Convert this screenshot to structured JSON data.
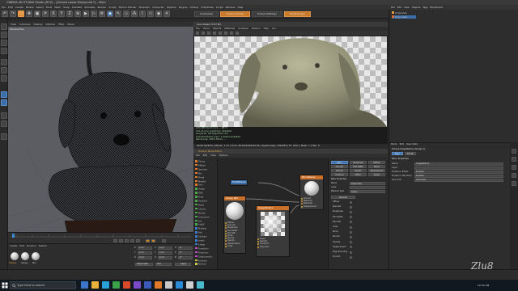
{
  "window": {
    "title": "CINEMA 4D STUDIO Studio (R19) – [Octane Loose Glossy.c4d *] – Main"
  },
  "menubar": [
    "File",
    "Edit",
    "Create",
    "Modes",
    "Select",
    "Tools",
    "Mesh",
    "Snap",
    "Animate",
    "Simulate",
    "Render",
    "Sculpt",
    "Motion Tracker",
    "MoGraph",
    "Character",
    "Pipeline",
    "Plugins",
    "Octane",
    "X-Particles",
    "Script",
    "Window",
    "Help"
  ],
  "toolbar": {
    "pills": [
      "LiveViewer",
      "Octane Render",
      "Octane Settings",
      "Tag Manager"
    ]
  },
  "viewport": {
    "menu": [
      "View",
      "Cameras",
      "Display",
      "Options",
      "Filter",
      "Panel"
    ],
    "label": "Perspective"
  },
  "render_view": {
    "title": "Live Viewer 3.07-R2",
    "menu": [
      "File",
      "Cloud",
      "Objects",
      "Materials",
      "Compare",
      "Options",
      "Help",
      "Gui"
    ],
    "status_line": "00:00:00/20/0  |  Ms/sec: 1.37  |  Time: 00:00:04/00:00:04  |  Spp/maxspp: 256/256  |  Tri: 0/3m  |  Mesh: 7  |  Hair: 0",
    "info_lines": [
      "GTX 980 Ti[1/1]  1/2  ...  98°C",
      "Out-of-core used/max: 0Kb/4Gb",
      "Grey8/16: 0/0  Rgb32/64: 0/1",
      "Used/free/total vram: 1.4Gb/4.2Gb/6Gb",
      "Rendering: 100%  Mode: ..."
    ]
  },
  "node_editor": {
    "title": "Octane Node Editor",
    "menu": [
      "File",
      "Edit",
      "View",
      "Options"
    ],
    "node_list": [
      {
        "label": "Glossy",
        "color": "#e07a2a"
      },
      {
        "label": "Diffuse",
        "color": "#e07a2a"
      },
      {
        "label": "Specular",
        "color": "#e07a2a"
      },
      {
        "label": "Mix",
        "color": "#e07a2a"
      },
      {
        "label": "Portal",
        "color": "#e07a2a"
      },
      {
        "label": "Metallic",
        "color": "#e07a2a"
      },
      {
        "label": "Toon",
        "color": "#e07a2a"
      },
      {
        "label": "Image",
        "color": "#4aa84a"
      },
      {
        "label": "RGB",
        "color": "#4aa84a"
      },
      {
        "label": "Float",
        "color": "#4aa84a"
      },
      {
        "label": "Gradient",
        "color": "#4aa84a"
      },
      {
        "label": "Noise",
        "color": "#4aa84a"
      },
      {
        "label": "Checks",
        "color": "#4aa84a"
      },
      {
        "label": "Marble",
        "color": "#4aa84a"
      },
      {
        "label": "Turbulence",
        "color": "#4aa84a"
      },
      {
        "label": "Dirt",
        "color": "#4aa84a"
      },
      {
        "label": "Falloff",
        "color": "#4aa84a"
      },
      {
        "label": "Multiply",
        "color": "#3a7ac8"
      },
      {
        "label": "Add",
        "color": "#3a7ac8"
      },
      {
        "label": "Subtract",
        "color": "#3a7ac8"
      },
      {
        "label": "Invert",
        "color": "#3a7ac8"
      },
      {
        "label": "Clamp",
        "color": "#3a7ac8"
      },
      {
        "label": "Transform",
        "color": "#c84ac8"
      },
      {
        "label": "Projection",
        "color": "#c84ac8"
      },
      {
        "label": "Displacement",
        "color": "#c84ac8"
      },
      {
        "label": "Emission",
        "color": "#c8c84a"
      },
      {
        "label": "Medium",
        "color": "#c8c84a"
      }
    ],
    "nodes": {
      "float": {
        "title": "FloatTexture"
      },
      "glossy": {
        "title": "Glossy Mat",
        "ports": [
          "Diffuse",
          "Specular",
          "Roughness",
          "Film Width",
          "Film IOR",
          "Bump",
          "Normal",
          "Opacity",
          "Displacement",
          "Index"
        ]
      },
      "image": {
        "title": "ImageTexture",
        "ports": [
          "Power",
          "Gamma",
          "Transform",
          "Projection"
        ]
      },
      "mix": {
        "title": "Mix Material",
        "ports": [
          "Amount",
          "Material1",
          "Material2",
          "Displacement"
        ]
      }
    },
    "props": {
      "tab_buttons": [
        "Basic",
        "Roughness",
        "Diffuse",
        "Specular",
        "Film Width",
        "Bump",
        "Normal",
        "Opacity",
        "Displacement",
        "Common",
        "Editor",
        "Assign"
      ],
      "section": "Basic Properties",
      "name_label": "Name",
      "name_value": "Glossy Mat",
      "layer_label": "Layer",
      "assign_label": "Material Type",
      "assign_value": "Glossy",
      "channel_header": "Specular",
      "checkboxes": [
        "Diffuse",
        "Specular",
        "Roughness",
        "Film Width",
        "Film IOR",
        "Index",
        "Bump",
        "Normal",
        "Opacity",
        "Displacement",
        "Edge Rounding",
        "Smooth"
      ]
    }
  },
  "materials": {
    "menu": [
      "Create",
      "Edit",
      "Function",
      "Texture"
    ],
    "names": [
      "Octane",
      "Glossy",
      "Mix"
    ]
  },
  "coords": {
    "rows": [
      [
        "X",
        "0 cm",
        "X",
        "0 cm",
        "H",
        "0°"
      ],
      [
        "Y",
        "0 cm",
        "Y",
        "0 cm",
        "P",
        "0°"
      ],
      [
        "Z",
        "0 cm",
        "Z",
        "0 cm",
        "B",
        "0°"
      ]
    ],
    "mode": "Object (Rel)",
    "size": "Size",
    "apply": "Apply"
  },
  "object_manager": {
    "menu": [
      "File",
      "Edit",
      "View",
      "Objects",
      "Tags",
      "Bookmarks"
    ],
    "rows": [
      {
        "label": "OctaneSky",
        "color": "#e0a040"
      },
      {
        "label": "Dog_mesh",
        "color": "#e06a2a"
      }
    ]
  },
  "attributes": {
    "menu": [
      "Mode",
      "Edit",
      "User Data"
    ],
    "header": "Octane ImageTexture [Image 1]",
    "tabs": [
      "Basic",
      "Shader"
    ],
    "section": "Basic Properties",
    "rows": [
      [
        "Name",
        "ImageTexture"
      ],
      [
        "Layer",
        ""
      ],
      [
        "Enable in Editor",
        "Enabled"
      ],
      [
        "Enable in Renderer",
        "Enabled"
      ],
      [
        "Use Color",
        "Automatic"
      ]
    ]
  },
  "taskbar": {
    "search_placeholder": "Type here to search",
    "clock_time": "10:34 AM",
    "clock_date": "3/21/2018",
    "app_colors": [
      "#3b76c9",
      "#e8b23a",
      "#2aa0d8",
      "#3ba04a",
      "#d84a2a",
      "#7a4ac8",
      "#3b5ab8",
      "#e07a2a",
      "#c8c8c8",
      "#2a8ad8",
      "#d0d0d0",
      "#4ab8c8"
    ]
  },
  "signature": "Zlu8",
  "colors": {
    "accent": "#e08a2c",
    "selection": "#3d6ea8"
  }
}
